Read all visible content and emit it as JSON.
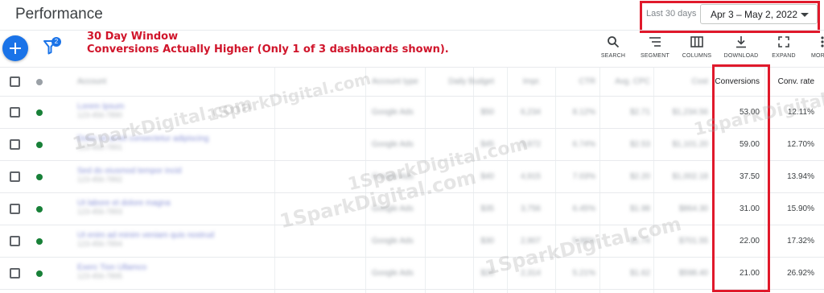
{
  "header": {
    "title": "Performance",
    "date_range_label": "Last 30 days",
    "date_range_value": "Apr 3 – May 2, 2022"
  },
  "toolbar": {
    "filter_badge": "2",
    "annotation_line1": "30 Day Window",
    "annotation_line2": "Conversions Actually Higher (Only 1 of 3 dashboards shown).",
    "tools": [
      {
        "label": "SEARCH",
        "icon": "search-icon"
      },
      {
        "label": "SEGMENT",
        "icon": "segment-icon"
      },
      {
        "label": "COLUMNS",
        "icon": "columns-icon"
      },
      {
        "label": "DOWNLOAD",
        "icon": "download-icon"
      },
      {
        "label": "EXPAND",
        "icon": "expand-icon"
      },
      {
        "label": "MORE",
        "icon": "more-icon"
      }
    ]
  },
  "table": {
    "headers": {
      "account": "Account",
      "account_type": "Account type",
      "budget": "Daily Budget",
      "impr": "Impr.",
      "ctr": "CTR",
      "avg_cpc": "Avg. CPC",
      "cost": "Cost",
      "conversions": "Conversions",
      "conv_rate": "Conv. rate"
    },
    "rows": [
      {
        "account": "Lorem Ipsum",
        "sub": "123-456-7890",
        "type": "Google Ads",
        "budget": "$50",
        "impr": "6,234",
        "ctr": "8.12%",
        "cpc": "$2.71",
        "cost": "$1,234.56",
        "conversions": "53.00",
        "conv_rate": "12.11%"
      },
      {
        "account": "Dolor sit amet consectetur adipiscing",
        "sub": "123-456-7891",
        "type": "Google Ads",
        "budget": "$45",
        "impr": "5,872",
        "ctr": "6.74%",
        "cpc": "$2.53",
        "cost": "$1,101.20",
        "conversions": "59.00",
        "conv_rate": "12.70%"
      },
      {
        "account": "Sed do eiusmod tempor incid",
        "sub": "123-456-7892",
        "type": "Google Ads",
        "budget": "$40",
        "impr": "4,915",
        "ctr": "7.03%",
        "cpc": "$2.20",
        "cost": "$1,002.18",
        "conversions": "37.50",
        "conv_rate": "13.94%"
      },
      {
        "account": "Ut labore et dolore magna",
        "sub": "123-456-7893",
        "type": "Google Ads",
        "budget": "$35",
        "impr": "3,756",
        "ctr": "6.45%",
        "cpc": "$1.98",
        "cost": "$864.30",
        "conversions": "31.00",
        "conv_rate": "15.90%"
      },
      {
        "account": "Ut enim ad minim veniam quis nostrud",
        "sub": "123-456-7894",
        "type": "Google Ads",
        "budget": "$30",
        "impr": "2,907",
        "ctr": "5.88%",
        "cpc": "$1.74",
        "cost": "$701.55",
        "conversions": "22.00",
        "conv_rate": "17.32%"
      },
      {
        "account": "Exerc Tion Ullamco",
        "sub": "123-456-7895",
        "type": "Google Ads",
        "budget": "$25",
        "impr": "2,314",
        "ctr": "5.21%",
        "cpc": "$1.62",
        "cost": "$598.40",
        "conversions": "21.00",
        "conv_rate": "26.92%"
      }
    ]
  },
  "watermark": "1SparkDigital.com",
  "colors": {
    "accent": "#1a73e8",
    "highlight": "#e0192b",
    "annotation": "#d0152b",
    "status_dot": "#188038"
  }
}
